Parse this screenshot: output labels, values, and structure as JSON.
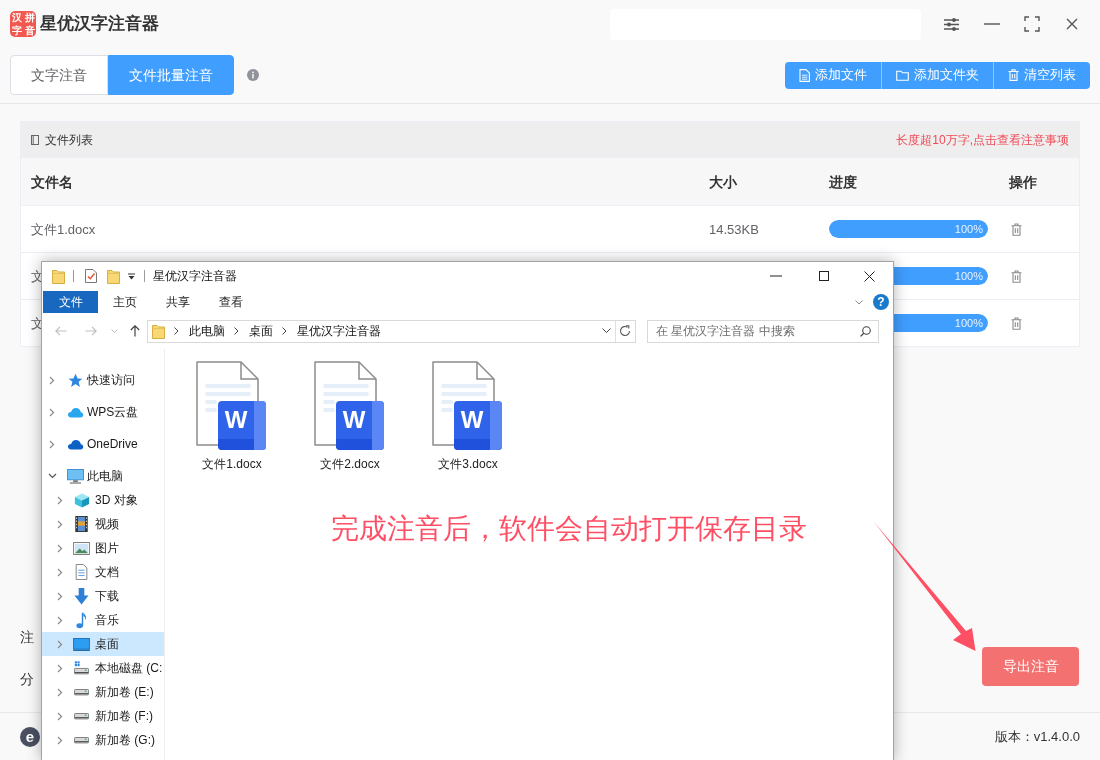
{
  "app": {
    "title": "星优汉字注音器",
    "logo_chars": [
      "汉",
      "拼",
      "字",
      "音"
    ]
  },
  "mode_tabs": [
    {
      "label": "文字注音",
      "selected": false
    },
    {
      "label": "文件批量注音",
      "selected": true
    }
  ],
  "toolbar": [
    {
      "kind": "file",
      "label": "添加文件"
    },
    {
      "kind": "folder",
      "label": "添加文件夹"
    },
    {
      "kind": "trash",
      "label": "清空列表"
    }
  ],
  "file_list": {
    "title": "文件列表",
    "notice": "长度超10万字,点击查看注意事项",
    "columns": [
      "文件名",
      "大小",
      "进度",
      "操作"
    ],
    "rows": [
      {
        "name": "文件1.docx",
        "size": "14.53KB",
        "level": 1,
        "reading": "100%"
      },
      {
        "name": "文",
        "level": 1,
        "reading": "100%"
      },
      {
        "name": "文",
        "level": 1,
        "reading": "100%"
      }
    ]
  },
  "settings": [
    {
      "label": "注"
    },
    {
      "label": "分"
    }
  ],
  "export_button": "导出注音",
  "footer": {
    "logo": "e",
    "version": "版本：v1.4.0.0"
  },
  "explorer": {
    "title": "星优汉字注音器",
    "ribbon_tabs": [
      {
        "kind": "menu",
        "label": "文件"
      },
      {
        "kind": "tab",
        "label": "主页"
      },
      {
        "kind": "tab",
        "label": "共享"
      },
      {
        "kind": "tab",
        "label": "查看"
      }
    ],
    "help": "?",
    "nav_buttons": [
      {
        "kind": "back",
        "disabled": true
      },
      {
        "kind": "forward",
        "disabled": true
      },
      {
        "kind": "recent",
        "disabled": true
      },
      {
        "kind": "up",
        "disabled": false
      }
    ],
    "path": [
      "此电脑",
      "桌面",
      "星优汉字注音器"
    ],
    "search": {
      "placeholder": "在 星优汉字注音器 中搜索"
    },
    "nav": [
      {
        "kind": "quick_access",
        "label": "快速访问",
        "expanded": false,
        "selected": false
      },
      {
        "kind": "wps_cloud",
        "label": "WPS云盘",
        "expanded": false,
        "selected": false
      },
      {
        "kind": "onedrive",
        "label": "OneDrive",
        "expanded": false,
        "selected": false
      },
      {
        "kind": "pc",
        "label": "此电脑",
        "expanded": true,
        "selected": false,
        "children": [
          {
            "kind": "cube",
            "label": "3D 对象",
            "expanded": false,
            "selected": false
          },
          {
            "kind": "video",
            "label": "视频",
            "expanded": false,
            "selected": false
          },
          {
            "kind": "picture",
            "label": "图片",
            "expanded": false,
            "selected": false
          },
          {
            "kind": "document",
            "label": "文档",
            "expanded": false,
            "selected": false
          },
          {
            "kind": "download",
            "label": "下载",
            "expanded": false,
            "selected": false
          },
          {
            "kind": "music",
            "label": "音乐",
            "expanded": false,
            "selected": false
          },
          {
            "kind": "desktop",
            "label": "桌面",
            "expanded": false,
            "selected": true
          },
          {
            "kind": "system_drive",
            "label": "本地磁盘 (C:",
            "expanded": false,
            "selected": false
          },
          {
            "kind": "drive",
            "label": "新加卷 (E:)",
            "expanded": false,
            "selected": false
          },
          {
            "kind": "drive",
            "label": "新加卷 (F:)",
            "expanded": false,
            "selected": false
          },
          {
            "kind": "drive",
            "label": "新加卷 (G:)",
            "expanded": false,
            "selected": false
          }
        ]
      }
    ],
    "files": [
      {
        "name": "文件1.docx",
        "badge": "W"
      },
      {
        "name": "文件2.docx",
        "badge": "W"
      },
      {
        "name": "文件3.docx",
        "badge": "W"
      }
    ]
  },
  "annotation": {
    "text": "完成注音后，软件会自动打开保存目录"
  }
}
